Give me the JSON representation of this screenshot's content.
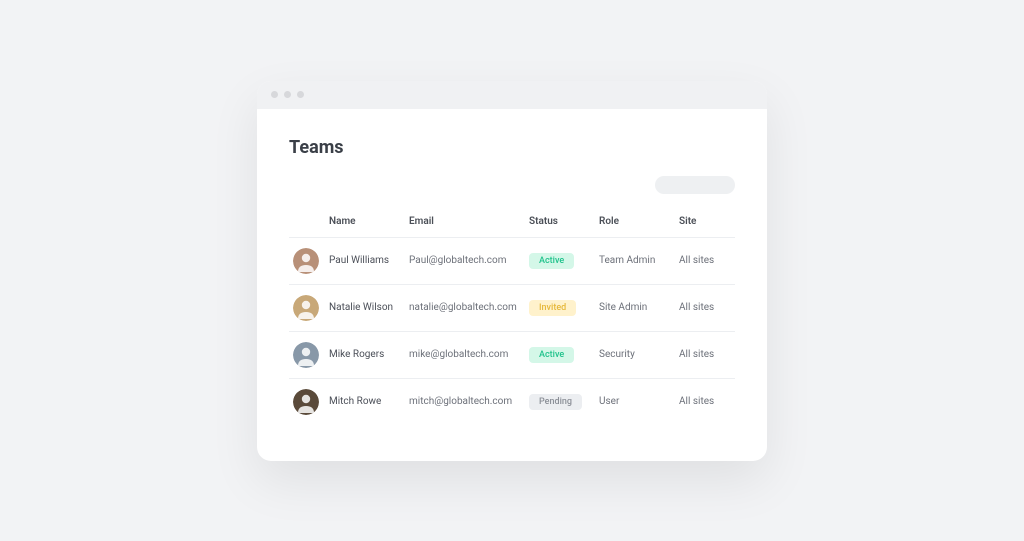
{
  "page": {
    "title": "Teams"
  },
  "columns": {
    "name": "Name",
    "email": "Email",
    "status": "Status",
    "role": "Role",
    "site": "Site"
  },
  "statusClasses": {
    "Active": "badge-active",
    "Invited": "badge-invited",
    "Pending": "badge-pending"
  },
  "avatarColors": [
    "#b89078",
    "#c8a878",
    "#8898a8",
    "#5a4a3a"
  ],
  "rows": [
    {
      "name": "Paul Williams",
      "email": "Paul@globaltech.com",
      "status": "Active",
      "role": "Team Admin",
      "site": "All sites"
    },
    {
      "name": "Natalie Wilson",
      "email": "natalie@globaltech.com",
      "status": "Invited",
      "role": "Site Admin",
      "site": "All sites"
    },
    {
      "name": "Mike Rogers",
      "email": "mike@globaltech.com",
      "status": "Active",
      "role": "Security",
      "site": "All sites"
    },
    {
      "name": "Mitch Rowe",
      "email": "mitch@globaltech.com",
      "status": "Pending",
      "role": "User",
      "site": "All sites"
    }
  ]
}
